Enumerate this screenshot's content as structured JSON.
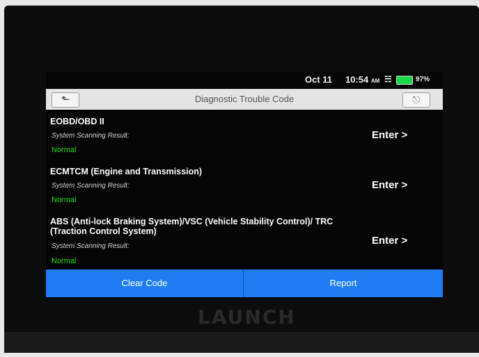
{
  "statusbar": {
    "date": "Oct 11",
    "time": "10:54",
    "am": "AM",
    "battery": "97%"
  },
  "header": {
    "title": "Diagnostic Trouble Code",
    "back_icon": "back-arrow-icon",
    "exit_icon": "exit-icon"
  },
  "systems": [
    {
      "name": "EOBD/OBD II",
      "sub": "System Scanning Result:",
      "status": "Normal",
      "enter": "Enter >"
    },
    {
      "name": "ECMTCM (Engine and Transmission)",
      "sub": "System Scanning Result:",
      "status": "Normal",
      "enter": "Enter >"
    },
    {
      "name": "ABS (Anti-lock Braking System)/VSC (Vehicle Stability Control)/ TRC (Traction Control System)",
      "sub": "System Scanning Result:",
      "status": "Normal",
      "enter": "Enter >"
    }
  ],
  "buttons": {
    "clear": "Clear Code",
    "report": "Report"
  },
  "brand": "LAUNCH",
  "colors": {
    "accent": "#1f7cf2",
    "normal": "#22e018",
    "header_bg": "#e4e4e4"
  }
}
